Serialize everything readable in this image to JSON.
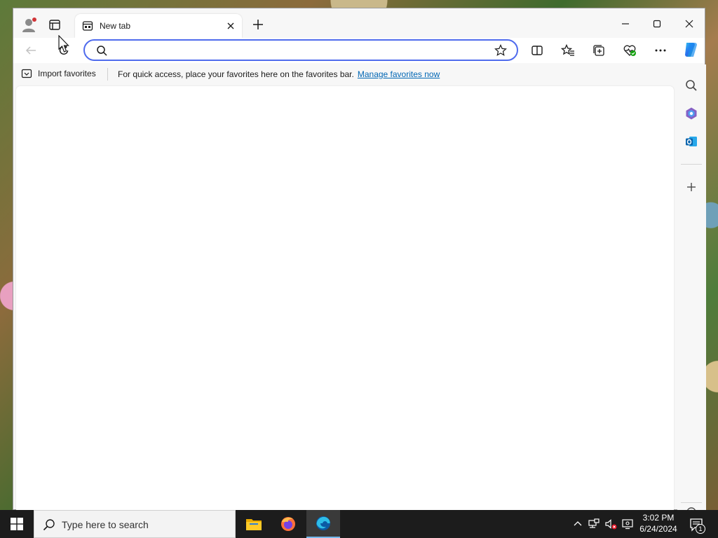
{
  "browser": {
    "tab": {
      "title": "New tab",
      "favicon": "newtab-page-icon"
    },
    "window_controls": [
      "minimize-icon",
      "maximize-icon",
      "close-icon"
    ],
    "address_bar": {
      "value": "",
      "placeholder": ""
    },
    "toolbar_icons": [
      "split-screen-icon",
      "favorites-icon",
      "collections-icon",
      "browser-essentials-icon",
      "more-icon",
      "copilot-icon"
    ],
    "favorites_bar": {
      "import_label": "Import favorites",
      "message": "For quick access, place your favorites here on the favorites bar.",
      "link_label": "Manage favorites now"
    },
    "sidebar_icons": [
      "search-icon",
      "copilot-app-icon",
      "outlook-icon",
      "add-icon",
      "settings-icon"
    ]
  },
  "taskbar": {
    "search_placeholder": "Type here to search",
    "apps": [
      "file-explorer-icon",
      "firefox-icon",
      "edge-icon"
    ],
    "active_app": "edge-icon",
    "time": "3:02 PM",
    "date": "6/24/2024",
    "notification_count": "1"
  },
  "colors": {
    "accent": "#4f6bed",
    "link": "#0066b4",
    "taskbar": "#1c1c1c",
    "notification_dot": "#d13438"
  }
}
